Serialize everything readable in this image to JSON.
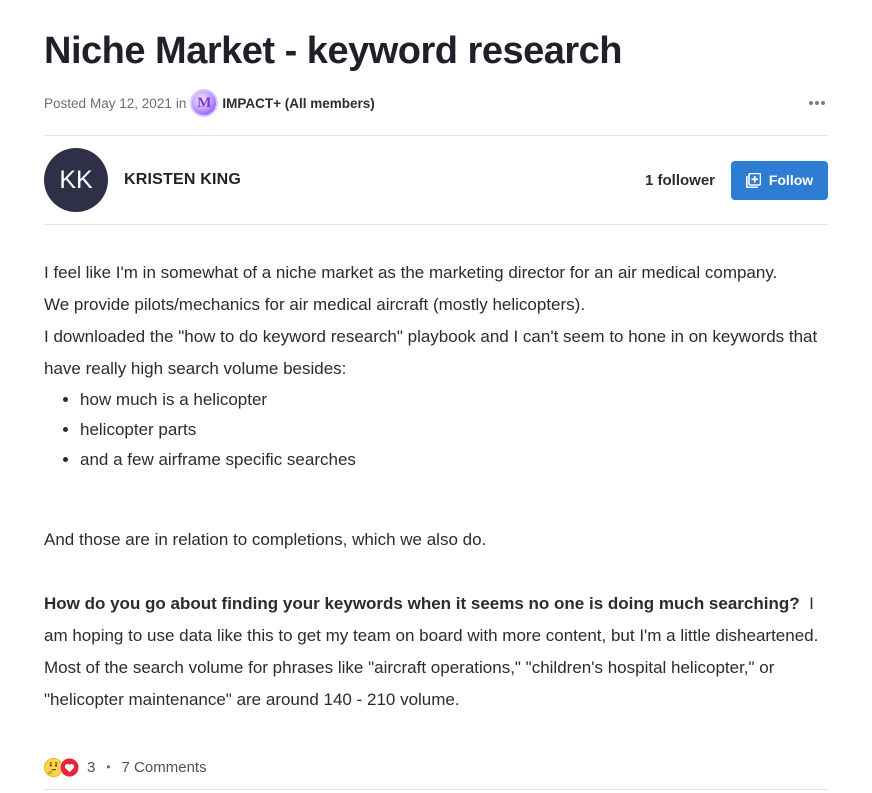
{
  "post": {
    "title": "Niche Market - keyword research",
    "posted_label": "Posted",
    "date": "May 12, 2021",
    "in_label": "in",
    "group_logo_letter": "M",
    "group_name": "IMPACT+ (All members)",
    "more_icon": "more-horizontal-icon"
  },
  "author": {
    "initials": "KK",
    "name": "KRISTEN KING",
    "followers": "1 follower",
    "follow_label": "Follow",
    "follow_icon": "follow-plus-icon",
    "avatar_color": "#2f3047",
    "button_color": "#2d7ed3"
  },
  "body": {
    "p1_line1": "I feel like I'm in somewhat of a niche market as the marketing director for an air medical company.",
    "p1_line2": "We provide pilots/mechanics for air medical aircraft (mostly helicopters).",
    "p2": "I downloaded the \"how to do keyword research\" playbook and I can't seem to hone in on keywords that have really high search volume besides:",
    "bullets": [
      "how much is a helicopter",
      "helicopter parts",
      "and a few airframe specific searches"
    ],
    "p3": "And those are in relation to completions, which we also do.",
    "p4_bold": "How do you go about finding your keywords when it seems no one is doing much searching?",
    "p4_rest": "  I am hoping to use data like this to get my team on board with more content, but I'm a little disheartened.  Most of the search volume for phrases like \"aircraft operations,\" \"children's hospital helicopter,\" or \"helicopter maintenance\" are around 140 - 210 volume."
  },
  "footer": {
    "reaction_icons": [
      "thinking-face-icon",
      "heart-icon"
    ],
    "reaction_count": "3",
    "separator": "•",
    "comments": "7 Comments"
  }
}
